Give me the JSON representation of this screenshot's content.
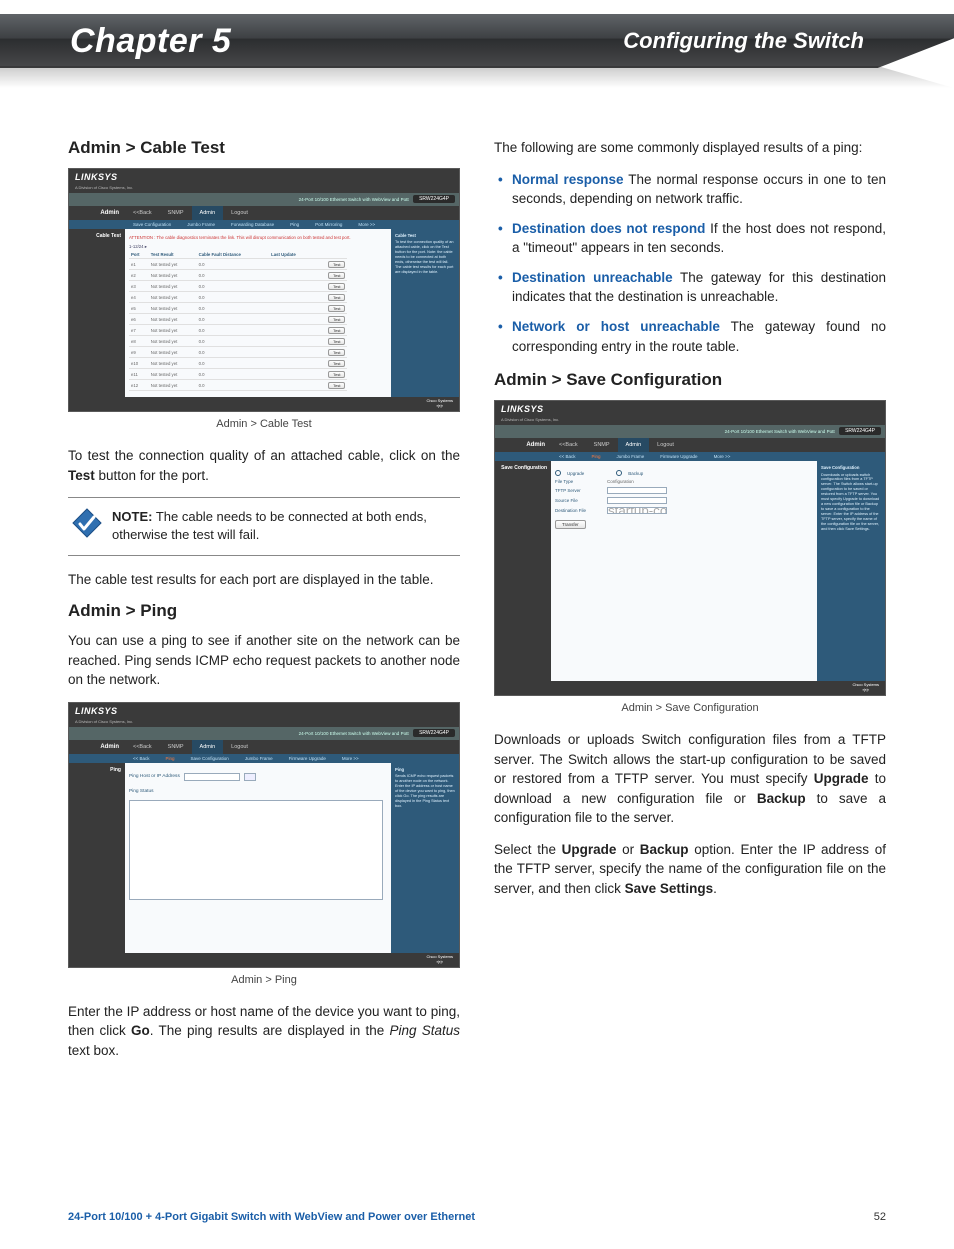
{
  "banner": {
    "chapter": "Chapter 5",
    "title": "Configuring the Switch"
  },
  "left": {
    "h_cable": "Admin > Cable Test",
    "cap_cable": "Admin > Cable Test",
    "p_cable_1a": "To test the connection quality of an attached cable, click on the ",
    "p_cable_1b": "Test",
    "p_cable_1c": " button for the port.",
    "note_label": "NOTE:",
    "note_text": " The cable needs to be connected at both ends, otherwise the test will fail.",
    "p_cable_2": "The cable test results for each port are displayed in the table.",
    "h_ping": "Admin > Ping",
    "p_ping_1": "You can use a ping to see if another site on the network can be reached. Ping sends ICMP echo request packets to another node on the network.",
    "cap_ping": "Admin > Ping",
    "p_ping_2a": "Enter the IP address or host name of the device you want to ping, then click ",
    "p_ping_2b": "Go",
    "p_ping_2c": ". The ping results are displayed in the ",
    "p_ping_2d": "Ping Status",
    "p_ping_2e": " text box."
  },
  "right": {
    "p_intro": "The following are some commonly displayed results of a ping:",
    "items": [
      {
        "term": "Normal response",
        "desc": "  The normal response occurs in one to ten seconds, depending on network traffic."
      },
      {
        "term": "Destination does not respond",
        "desc": "  If the host does not respond, a \"timeout\" appears in ten seconds."
      },
      {
        "term": "Destination unreachable",
        "desc": " The gateway for this destination indicates that the destination is unreachable."
      },
      {
        "term": "Network or host unreachable",
        "desc": "  The gateway found no corresponding entry in the route table."
      }
    ],
    "h_save": "Admin > Save Configuration",
    "cap_save": "Admin > Save Configuration",
    "p_save_1a": "Downloads or uploads Switch configuration files from a TFTP server. The Switch allows the start-up configuration to be saved or restored from a TFTP server. You must specify ",
    "p_save_1b": "Upgrade",
    "p_save_1c": " to download a new configuration file or ",
    "p_save_1d": "Backup",
    "p_save_1e": " to save a configuration file to the server.",
    "p_save_2a": "Select the ",
    "p_save_2b": "Upgrade",
    "p_save_2c": " or ",
    "p_save_2d": "Backup",
    "p_save_2e": " option. Enter the IP address of the TFTP server, specify the name of the configuration file on the server, and then click ",
    "p_save_2f": "Save Settings",
    "p_save_2g": "."
  },
  "shots": {
    "brand": "LINKSYS",
    "brand_sub": "A Division of Cisco Systems, Inc.",
    "model": "SRW224G4P",
    "device": "24-Port 10/100 Ethernet Switch with WebView and PoE",
    "admin": "Admin",
    "nav": [
      "<<Back",
      "SNMP",
      "Admin",
      "Logout"
    ],
    "cable": {
      "rail": "Cable Test",
      "sub": [
        "Save Configuration",
        "Jumbo Frame",
        "Forwarding Database",
        "Ping",
        "Port Mirroring",
        "More >>"
      ],
      "warn": "ATTENTION : The cable diagnostics terminates the link. This will disrupt communication on both tested and test port.",
      "pager": "1-12/24 ▸",
      "cols": [
        "Port",
        "Test Result",
        "Cable Fault Distance",
        "Last Update",
        ""
      ],
      "rows": [
        [
          "e1",
          "Not tested yet",
          "0.0",
          "",
          "Test"
        ],
        [
          "e2",
          "Not tested yet",
          "0.0",
          "",
          "Test"
        ],
        [
          "e3",
          "Not tested yet",
          "0.0",
          "",
          "Test"
        ],
        [
          "e4",
          "Not tested yet",
          "0.0",
          "",
          "Test"
        ],
        [
          "e5",
          "Not tested yet",
          "0.0",
          "",
          "Test"
        ],
        [
          "e6",
          "Not tested yet",
          "0.0",
          "",
          "Test"
        ],
        [
          "e7",
          "Not tested yet",
          "0.0",
          "",
          "Test"
        ],
        [
          "e8",
          "Not tested yet",
          "0.0",
          "",
          "Test"
        ],
        [
          "e9",
          "Not tested yet",
          "0.0",
          "",
          "Test"
        ],
        [
          "e10",
          "Not tested yet",
          "0.0",
          "",
          "Test"
        ],
        [
          "e11",
          "Not tested yet",
          "0.0",
          "",
          "Test"
        ],
        [
          "e12",
          "Not tested yet",
          "0.0",
          "",
          "Test"
        ]
      ],
      "help_t": "Cable Test",
      "help": "To test the connection quality of an attached cable, click on the Test button for the port. Note: the cable needs to be connected at both ends, otherwise the test will fail. The cable test results for each port are displayed in the table."
    },
    "ping": {
      "rail": "Ping",
      "sub": [
        "<< Back",
        "Ping",
        "Save Configuration",
        "Jumbo Frame",
        "Firmware Upgrade",
        "More >>"
      ],
      "lbl_ip": "Ping Host or IP Address",
      "lbl_status": "Ping Status",
      "help_t": "Ping",
      "help": "Sends ICMP echo request packets to another node on the network. Enter the IP address or host name of the device you want to ping, then click Go. The ping results are displayed in the Ping Status text box."
    },
    "save": {
      "rail": "Save Configuration",
      "sub": [
        "<< Back",
        "Ping",
        "Jumbo Frame",
        "Firmware Upgrade",
        "More >>"
      ],
      "r1": "Upgrade",
      "r2": "Backup",
      "f1": "File Type",
      "f1v": "Configuration",
      "f2": "TFTP Server",
      "f3": "Source File",
      "f4": "Destination File",
      "f4v": "startup-config",
      "btn": "Transfer",
      "help_t": "Save Configuration",
      "help": "Downloads or uploads switch configuration files from a TFTP server. The Switch allows start-up configuration to be saved or restored from a TFTP server. You must specify Upgrade to download a new configuration file or Backup to save a configuration to the server. Enter the IP address of the TFTP server, specify the name of the configuration file on the server, and then click Save Settings."
    }
  },
  "footer": {
    "product": "24-Port 10/100 + 4-Port Gigabit Switch with WebView and Power over Ethernet",
    "page": "52"
  }
}
